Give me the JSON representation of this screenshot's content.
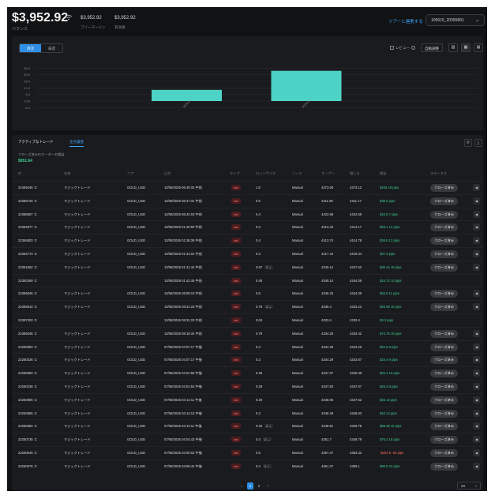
{
  "header": {
    "balance": "$3,952.92",
    "balance_label": "バランス",
    "stat1_value": "$3,952.92",
    "stat1_label": "フリーマージン",
    "stat2_value": "$3,952.92",
    "stat2_label": "有効値",
    "account_link": "ツアーと連携する",
    "account_select": "105615_20395891"
  },
  "chart_panel": {
    "seg_left": "月次",
    "seg_right": "日次",
    "preview_label": "レビュー",
    "auto_adjust": "自動調整",
    "view_buttons": [
      "▥",
      "▦",
      "▤"
    ]
  },
  "chart_data": {
    "type": "bar",
    "categories": [
      "2026-01",
      "2026-02"
    ],
    "values": [
      8.5,
      23
    ],
    "ylim": [
      -6,
      30
    ],
    "y_ticks": [
      "25.0",
      "20.0",
      "15.0",
      "10.0",
      "5.0",
      "0.00",
      "-5.0"
    ],
    "grid": true,
    "colors": {
      "bar": "#4cd3c5"
    }
  },
  "trades": {
    "tab_active": "アクティブなトレード",
    "tab_history": "注文履歴",
    "closed_label": "クローズ済みのオーダーの損益",
    "closed_value": "$951.64",
    "columns": [
      "ID",
      "名前",
      "ペア",
      "日付",
      "タイプ",
      "ロットサイズ",
      "ソース",
      "オープン",
      "閉じる",
      "損益",
      "ステータス"
    ],
    "rows": [
      {
        "id": "22489446",
        "name": "マジックトレード",
        "pair": "GOLD_USD",
        "date": "10/08/2026 06:49:33 午前",
        "type": "sell",
        "lot": "1.5",
        "stepper": "",
        "source": "Manual",
        "open": "4373.08",
        "close": "4373.12",
        "pnl": "$448.18 pips",
        "pnl_color": "green",
        "status": "クローズ済み"
      },
      {
        "id": "22386728",
        "name": "マジックトレード",
        "pair": "GOLD_USD",
        "date": "10/08/2026 06:47:31 午前",
        "type": "sell",
        "lot": "0.5",
        "stepper": "",
        "source": "Manual",
        "open": "4411.95",
        "close": "4411.17",
        "pnl": "$35.6 pips",
        "pnl_color": "green",
        "status": "クローズ済み"
      },
      {
        "id": "22386807",
        "name": "マジックトレード",
        "pair": "GOLD_USD",
        "date": "10/08/2026 06:42:03 午前",
        "type": "sell",
        "lot": "0.4",
        "stepper": "",
        "source": "Manual",
        "open": "4422.69",
        "close": "4422.59",
        "pnl": "$42.6 7 pips",
        "pnl_color": "green",
        "status": "クローズ済み"
      },
      {
        "id": "22384977",
        "name": "マジックトレード",
        "pair": "GOLD_USD",
        "date": "10/08/2026 01:49:00 午前",
        "type": "sell",
        "lot": "0.3",
        "stepper": "",
        "source": "Manual",
        "open": "4413.42",
        "close": "4413.17",
        "pnl": "$29.1 12 pips",
        "pnl_color": "green",
        "status": "クローズ済み"
      },
      {
        "id": "22384803",
        "name": "マジックトレード",
        "pair": "GOLD_USD",
        "date": "10/08/2026 01:38:38 午前",
        "type": "sell",
        "lot": "0.4",
        "stepper": "",
        "source": "Manual",
        "open": "4413.74",
        "close": "4414.78",
        "pnl": "$36.6 12 pips",
        "pnl_color": "green",
        "status": "クローズ済み"
      },
      {
        "id": "22364773",
        "name": "マジックトレード",
        "pair": "GOLD_USD",
        "date": "10/08/2026 01:31:04 午前",
        "type": "sell",
        "lot": "0.3",
        "stepper": "",
        "source": "Manual",
        "open": "4417.44",
        "close": "4418.34",
        "pnl": "$37.3 pips",
        "pnl_color": "green",
        "status": "クローズ済み"
      },
      {
        "id": "22351662",
        "name": "マジックトレード",
        "pair": "GOLD_USD",
        "date": "10/08/2026 01:41:44 午前",
        "type": "sell",
        "lot": "0.67",
        "stepper": "2",
        "source": "Manual",
        "open": "4349.14",
        "close": "4347.62",
        "pnl": "$30.44 18 pips",
        "pnl_color": "green",
        "status": "クローズ済み"
      },
      {
        "id": "22350269",
        "name": "",
        "pair": "",
        "date": "10/08/2026 01:42:46 午前",
        "type": "sell",
        "lot": "0.48",
        "stepper": "",
        "source": "Manual",
        "open": "4349.14",
        "close": "4344.09",
        "pnl": "$24.72 10 pips",
        "pnl_color": "green",
        "status": ""
      },
      {
        "id": "22386646",
        "name": "マジックトレード",
        "pair": "GOLD_USD",
        "date": "10/08/2026 08:08:10 午前",
        "type": "sell",
        "lot": "0.5",
        "stepper": "",
        "source": "Manual",
        "open": "4345.34",
        "close": "4344.09",
        "pnl": "$62.9 11 pips",
        "pnl_color": "green",
        "status": "クローズ済み"
      },
      {
        "id": "22386510",
        "name": "マジックトレード",
        "pair": "GOLD_USD",
        "date": "10/08/2026 08:31:23 午前",
        "type": "sell",
        "lot": "0.76",
        "stepper": "2",
        "source": "Manual",
        "open": "4335.4",
        "close": "4333.22",
        "pnl": "$46.98 10 pips",
        "pnl_color": "green",
        "status": "クローズ済み"
      },
      {
        "id": "22387203",
        "name": "",
        "pair": "",
        "date": "10/08/2026 08:31:23 午前",
        "type": "sell",
        "lot": "0.04",
        "stepper": "",
        "source": "Manual",
        "open": "4333.4",
        "close": "4333.4",
        "pnl": "$3 3 pips",
        "pnl_color": "green",
        "status": ""
      },
      {
        "id": "22386046",
        "name": "マジックトレード",
        "pair": "GOLD_USD",
        "date": "10/08/2026 08:18:34 午前",
        "type": "sell",
        "lot": "0.79",
        "stepper": "",
        "source": "Manual",
        "open": "4334.25",
        "close": "4333.42",
        "pnl": "$72.75 10 pips",
        "pnl_color": "green",
        "status": "クローズ済み"
      },
      {
        "id": "22260953",
        "name": "マジックトレード",
        "pair": "GOLD_USD",
        "date": "07/08/2026 04:07:17 午後",
        "type": "sell",
        "lot": "0.4",
        "stepper": "",
        "source": "Manual",
        "open": "4344.36",
        "close": "4343.26",
        "pnl": "$42.6 9 pips",
        "pnl_color": "green",
        "status": "クローズ済み"
      },
      {
        "id": "22260336",
        "name": "マジックトレード",
        "pair": "GOLD_USD",
        "date": "07/08/2026 04:07:17 午後",
        "type": "sell",
        "lot": "0.2",
        "stepper": "",
        "source": "Manual",
        "open": "4344.29",
        "close": "4343.67",
        "pnl": "$16.4 9 pips",
        "pnl_color": "green",
        "status": "クローズ済み"
      },
      {
        "id": "22260950",
        "name": "マジックトレード",
        "pair": "GOLD_USD",
        "date": "07/08/2026 04:01:58 午後",
        "type": "sell",
        "lot": "0.39",
        "stepper": "",
        "source": "Manual",
        "open": "4347.37",
        "close": "4346.39",
        "pnl": "$34.3 10 pips",
        "pnl_color": "green",
        "status": "クローズ済み"
      },
      {
        "id": "22260238",
        "name": "マジックトレード",
        "pair": "GOLD_USD",
        "date": "07/08/2026 04:01:53 午後",
        "type": "sell",
        "lot": "0.29",
        "stepper": "",
        "source": "Manual",
        "open": "4347.83",
        "close": "4347.07",
        "pnl": "$25.3 8 pips",
        "pnl_color": "green",
        "status": "クローズ済み"
      },
      {
        "id": "22260806",
        "name": "マジックトレード",
        "pair": "GOLD_USD",
        "date": "07/08/2026 04:14:11 午後",
        "type": "sell",
        "lot": "0.29",
        "stepper": "",
        "source": "Manual",
        "open": "4348.05",
        "close": "4347.62",
        "pnl": "$28.12 pips",
        "pnl_color": "green",
        "status": "クローズ済み"
      },
      {
        "id": "22250665",
        "name": "マジックトレード",
        "pair": "GOLD_USD",
        "date": "07/08/2026 04:14:13 午後",
        "type": "sell",
        "lot": "0.3",
        "stepper": "",
        "source": "Manual",
        "open": "4348.49",
        "close": "4348.63",
        "pnl": "$42.14 pips",
        "pnl_color": "green",
        "status": "クローズ済み"
      },
      {
        "id": "22250684",
        "name": "マジックトレード",
        "pair": "GOLD_USD",
        "date": "07/08/2026 04:13:11 午後",
        "type": "sell",
        "lot": "0.32",
        "stepper": "2",
        "source": "Manual",
        "open": "4348.51",
        "close": "4346.78",
        "pnl": "$56.36 15 pips",
        "pnl_color": "green",
        "status": "クローズ済み"
      },
      {
        "id": "22250735",
        "name": "マジックトレード",
        "pair": "GOLD_USD",
        "date": "07/08/2026 04:04:43 午後",
        "type": "sell",
        "lot": "0.4",
        "stepper": "2",
        "source": "Manual",
        "open": "4351.7",
        "close": "4349.79",
        "pnl": "$76.4 15 pips",
        "pnl_color": "green",
        "status": "クローズ済み"
      },
      {
        "id": "22260645",
        "name": "マジックトレード",
        "pair": "GOLD_USD",
        "date": "07/08/2026 04:00:02 午後",
        "type": "sell",
        "lot": "0.5",
        "stepper": "",
        "source": "Manual",
        "open": "4357.47",
        "close": "4363.32",
        "pnl": "-$292.5 -59 pips",
        "pnl_color": "red",
        "status": "クローズ済み"
      },
      {
        "id": "22260576",
        "name": "マジックトレード",
        "pair": "GOLD_USD",
        "date": "07/08/2026 03:56:42 午後",
        "type": "sell",
        "lot": "0.4",
        "stepper": "2",
        "source": "Manual",
        "open": "4361.37",
        "close": "4359.1",
        "pnl": "$90.8 22 pips",
        "pnl_color": "green",
        "status": "クローズ済み"
      }
    ],
    "pages": [
      "‹",
      "1",
      "2",
      "›"
    ],
    "current_page": "1",
    "per_page": "20"
  }
}
